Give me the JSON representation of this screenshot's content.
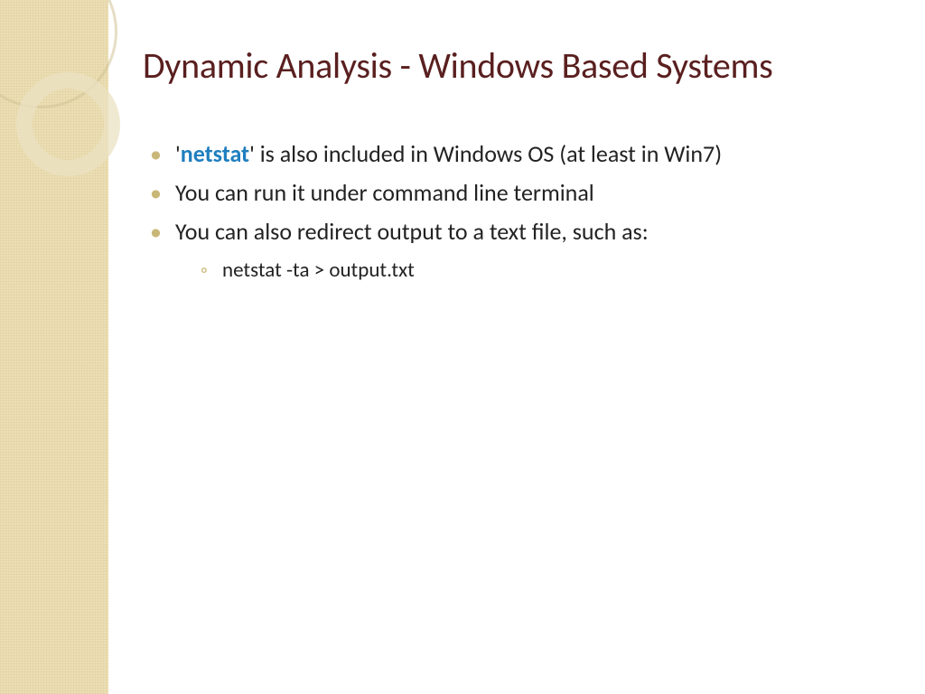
{
  "title": "Dynamic Analysis - Windows Based Systems",
  "bullets": {
    "b1_prefix": "'",
    "b1_keyword": "netstat",
    "b1_suffix": "' is also included in Windows OS (at least in Win7)",
    "b2": "You can run it under command line terminal",
    "b3": "You can also redirect output to a text file, such as:",
    "b3_sub1": "netstat -ta > output.txt"
  }
}
